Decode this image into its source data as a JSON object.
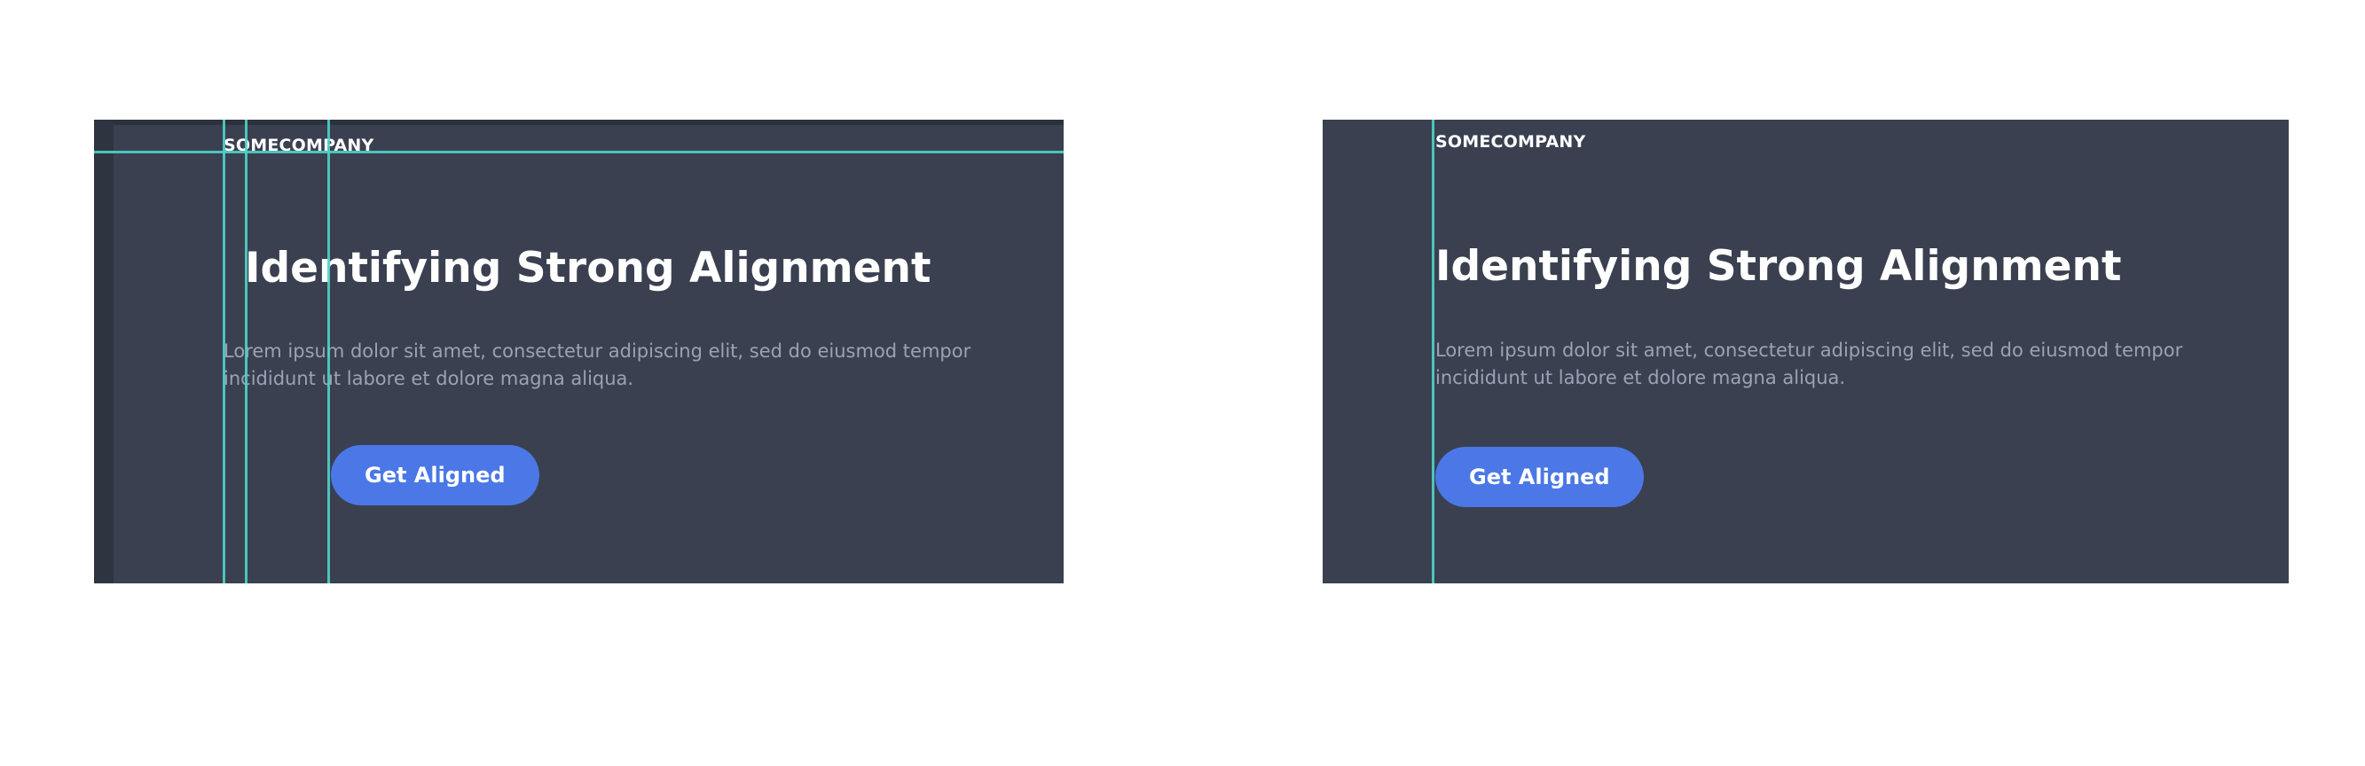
{
  "panels": {
    "left": {
      "brand": "SOMECOMPANY",
      "headline": "Identifying Strong Alignment",
      "body": "Lorem ipsum dolor sit amet, consectetur adipiscing elit, sed do eiusmod tempor incididunt ut labore et dolore magna aliqua.",
      "button_label": "Get Aligned"
    },
    "right": {
      "brand": "SOMECOMPANY",
      "headline": "Identifying Strong Alignment",
      "body": "Lorem ipsum dolor sit amet, consectetur adipiscing elit, sed do eiusmod tempor incididunt ut labore et dolore magna aliqua.",
      "button_label": "Get Aligned"
    }
  },
  "colors": {
    "panel_background": "#3a4050",
    "guide_line": "#4fd3c6",
    "button": "#4b78e6",
    "body_text": "#9aa2b4",
    "page_background": "#ffffff"
  }
}
